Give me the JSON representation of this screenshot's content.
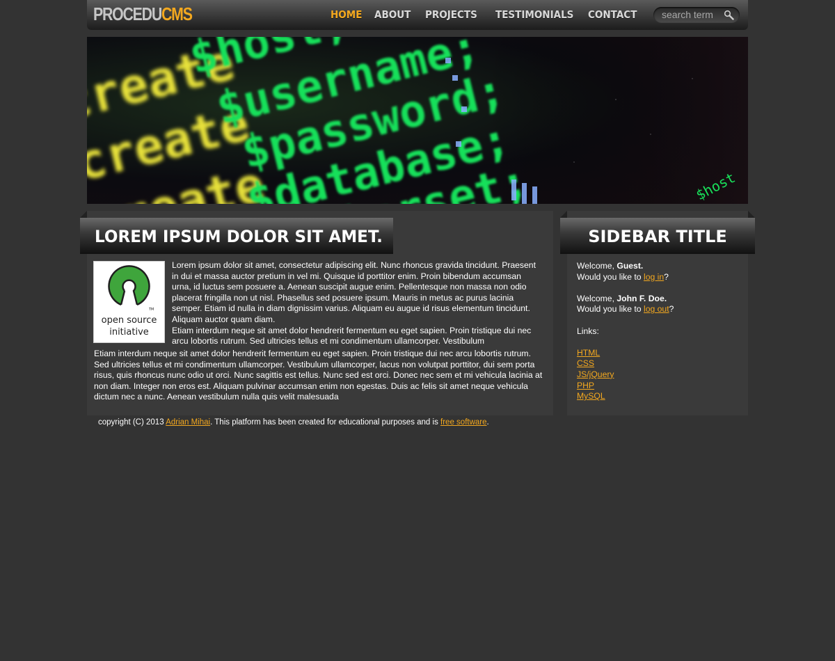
{
  "header": {
    "logo_part1": "PROCEDU",
    "logo_part2": "CMS",
    "nav": [
      {
        "label": "HOME",
        "active": true
      },
      {
        "label": "ABOUT",
        "active": false
      },
      {
        "label": "PROJECTS",
        "active": false
      },
      {
        "label": "TESTIMONIALS",
        "active": false
      },
      {
        "label": "CONTACT",
        "active": false
      }
    ],
    "search_placeholder": "search term"
  },
  "banner": {
    "code_tokens": [
      "$host;",
      "$username;",
      "$password;",
      "$database;",
      "$charset;",
      "create",
      "create",
      "create",
      "$host"
    ]
  },
  "main": {
    "title": "LOREM IPSUM DOLOR SIT AMET.",
    "logo": {
      "line1": "open source",
      "line2": "initiative",
      "tm": "TM"
    },
    "paragraph1": "Lorem ipsum dolor sit amet, consectetur adipiscing elit. Nunc rhoncus gravida tincidunt. Praesent in dui et massa auctor pretium in vel mi. Quisque id porttitor enim. Proin bibendum accumsan urna, id luctus sem posuere a. Aenean suscipit augue enim. Pellentesque non massa non odio placerat fringilla non ut nisl. Phasellus sed posuere ipsum. Mauris in metus ac purus lacinia semper. Etiam id nulla in diam dignissim varius. Aliquam eu augue id risus elementum tincidunt. Aliquam auctor quam diam.",
    "paragraph2": "Etiam interdum neque sit amet dolor hendrerit fermentum eu eget sapien. Proin tristique dui nec arcu lobortis rutrum. Sed ultricies tellus et mi condimentum ullamcorper. Vestibulum",
    "paragraph3": "Etiam interdum neque sit amet dolor hendrerit fermentum eu eget sapien. Proin tristique dui nec arcu lobortis rutrum. Sed ultricies tellus et mi condimentum ullamcorper. Vestibulum ullamcorper, lacus non volutpat porttitor, dui sem porta risus, quis rhoncus nunc odio ut orci. Nunc sagittis est tellus. Nunc sed est orci. Donec nec sem et mi vehicula lacinia at non diam. Integer non eros est. Aliquam pulvinar accumsan enim non egestas. Duis ac felis sit amet neque vehicula dictum nec a nunc. Aenean vestibulum nulla quis velit malesuada"
  },
  "sidebar": {
    "title": "SIDEBAR TITLE",
    "welcome1_prefix": "Welcome, ",
    "welcome1_name": "Guest.",
    "question1_prefix": "Would you like to ",
    "login_link": "log in",
    "question_suffix": "?",
    "welcome2_prefix": "Welcome, ",
    "welcome2_name": "John F. Doe.",
    "question2_prefix": "Would you like to ",
    "logout_link": "log out",
    "links_label": "Links:",
    "links": [
      "HTML",
      "CSS",
      "JS/jQuery",
      "PHP",
      "MySQL"
    ]
  },
  "footer": {
    "prefix": "copyright (C) 2013 ",
    "author_link": "Adrian Mihai",
    "middle": ". This platform has been created for educational purposes and is ",
    "license_link": "free software",
    "suffix": "."
  },
  "colors": {
    "background": "#333333",
    "panel": "#3a3a3a",
    "accent": "#f3a81f",
    "code_green": "#19e05a",
    "code_yellow": "#e8e23a"
  },
  "icons": {
    "search": "magnifier-icon",
    "osi": "open-source-keyhole-logo"
  }
}
